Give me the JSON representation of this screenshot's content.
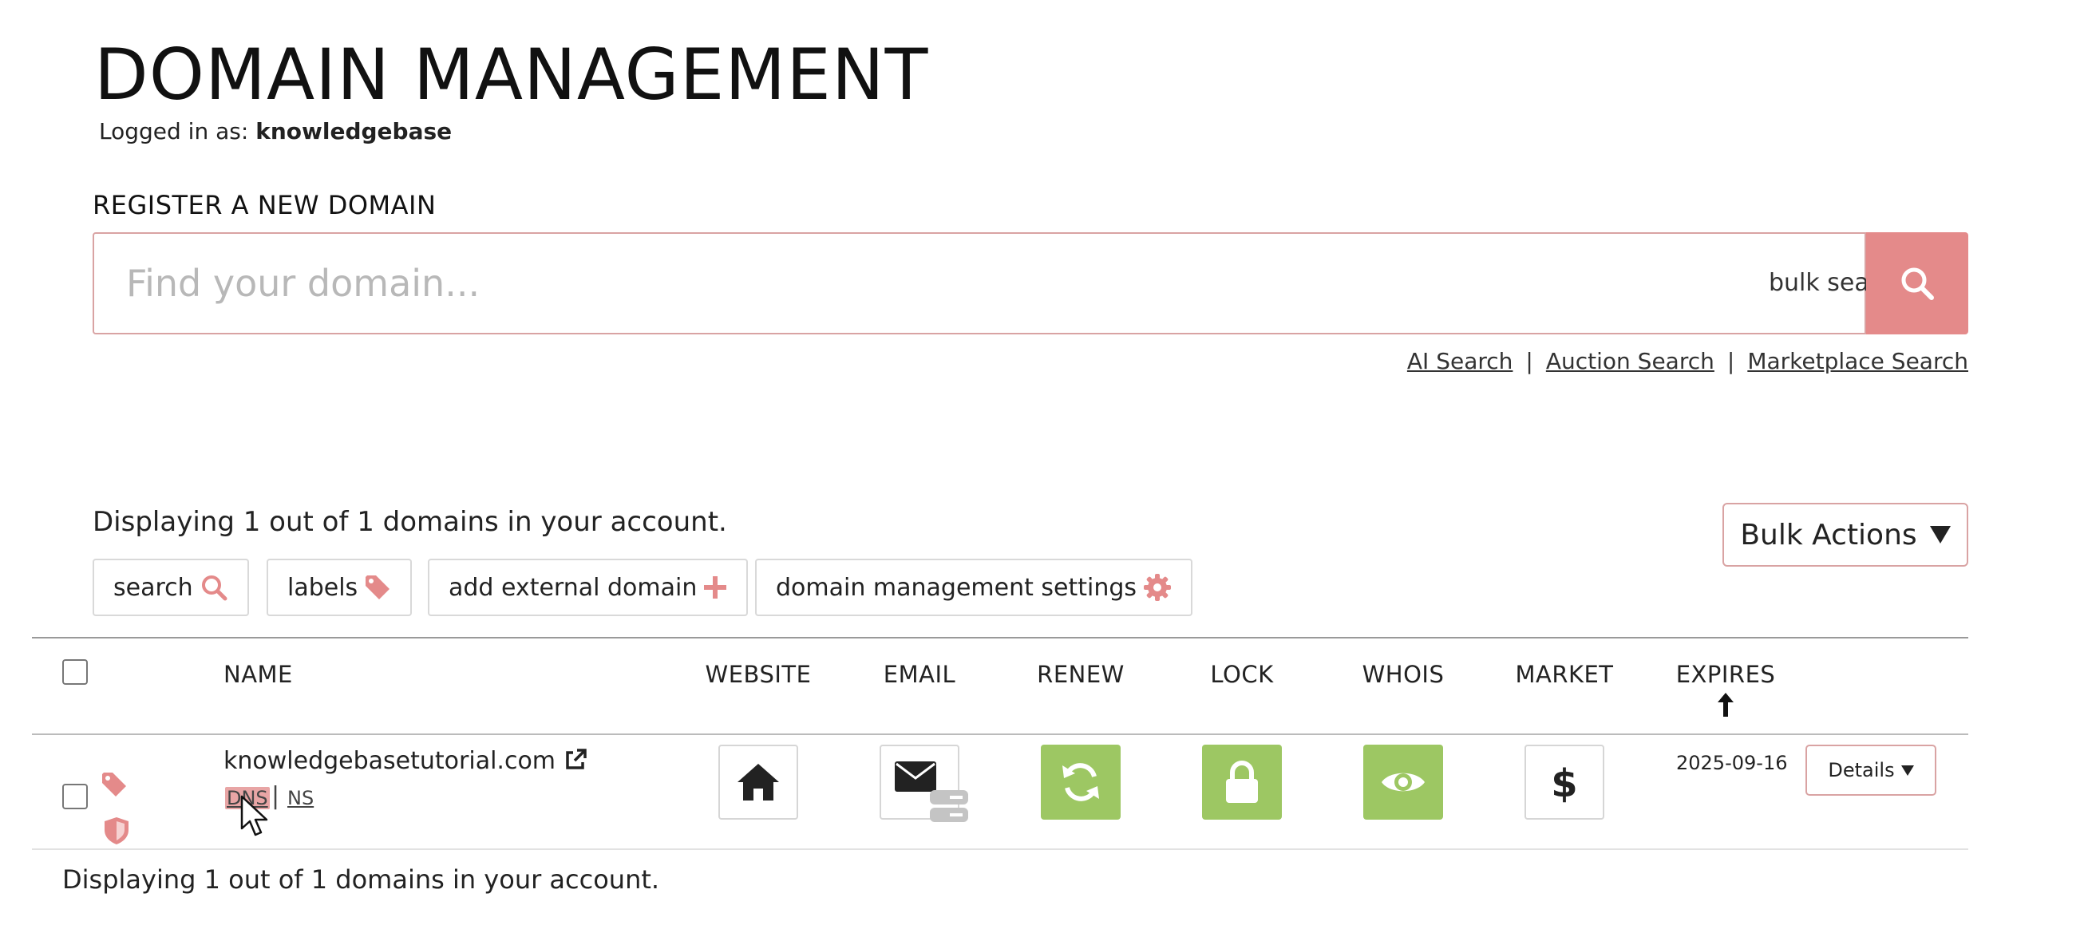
{
  "header": {
    "title": "DOMAIN MANAGEMENT",
    "logged_in_prefix": "Logged in as: ",
    "username": "knowledgebase"
  },
  "register": {
    "label": "REGISTER A NEW DOMAIN",
    "placeholder": "Find your domain...",
    "bulk_search_label": "bulk search"
  },
  "search_links": {
    "ai": "AI Search",
    "auction": "Auction Search",
    "marketplace": "Marketplace Search",
    "separator": "|"
  },
  "summary": {
    "top": "Displaying 1 out of 1 domains in your account.",
    "bottom": "Displaying 1 out of 1 domains in your account."
  },
  "bulk_actions_label": "Bulk Actions",
  "toolbar": {
    "search": "search",
    "labels": "labels",
    "add_external": "add external domain",
    "settings": "domain management settings"
  },
  "table": {
    "columns": {
      "name": "NAME",
      "website": "WEBSITE",
      "email": "EMAIL",
      "renew": "RENEW",
      "lock": "LOCK",
      "whois": "WHOIS",
      "market": "MARKET",
      "expires": "EXPIRES"
    },
    "rows": [
      {
        "domain": "knowledgebasetutorial.com",
        "dns_label": "DNS",
        "ns_label": "NS",
        "separator": "|",
        "expires": "2025-09-16",
        "details_label": "Details",
        "renew_active": true,
        "lock_active": true,
        "whois_active": true
      }
    ]
  },
  "colors": {
    "accent": "#e48a8a",
    "accent_border": "#d9a3a3",
    "active_green": "#9dc763"
  }
}
